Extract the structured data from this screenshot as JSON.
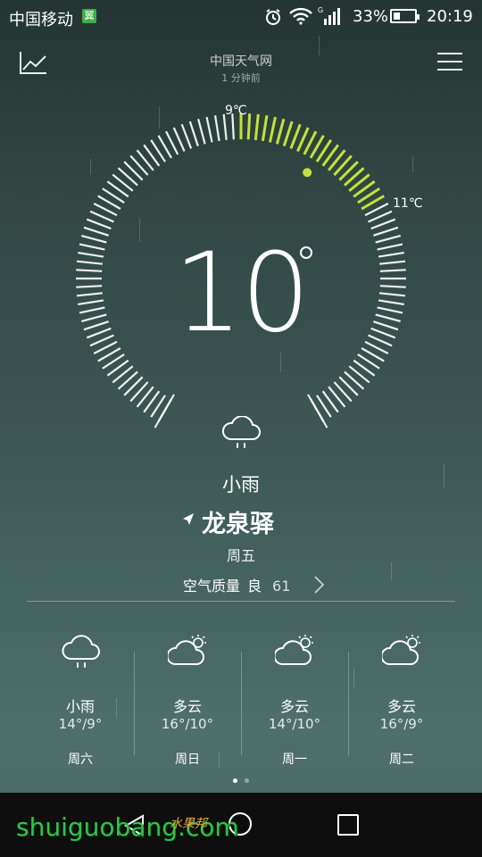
{
  "status_bar": {
    "carrier": "中国移动",
    "carrier_badge": "翼",
    "battery": "33%",
    "battery_level": 0.33,
    "time": "20:19",
    "icons": [
      "alarm-icon",
      "wifi-icon",
      "signal-icon",
      "battery-icon"
    ]
  },
  "header": {
    "source": "中国天气网",
    "updated": "1 分钟前",
    "icons": [
      "trend-chart-icon",
      "menu-icon"
    ]
  },
  "today": {
    "current_temp": "10",
    "high": "9℃",
    "low": "11℃",
    "condition": "小雨",
    "condition_icon": "light-rain-icon",
    "location": "龙泉驿",
    "weekday": "周五",
    "air_quality_label": "空气质量",
    "air_quality_level": "良",
    "air_quality_value": "61"
  },
  "forecast": [
    {
      "condition": "小雨",
      "range": "14°/9°",
      "day": "周六",
      "icon": "light-rain-icon"
    },
    {
      "condition": "多云",
      "range": "16°/10°",
      "day": "周日",
      "icon": "partly-cloudy-icon"
    },
    {
      "condition": "多云",
      "range": "14°/10°",
      "day": "周一",
      "icon": "partly-cloudy-icon"
    },
    {
      "condition": "多云",
      "range": "16°/9°",
      "day": "周二",
      "icon": "partly-cloudy-icon"
    }
  ],
  "pager": {
    "pages": 2,
    "current": 1
  },
  "colors": {
    "accent": "#c6e03a",
    "nav_bar": "#0e0e0e",
    "watermark": "#31c44a"
  },
  "watermark": {
    "text": "shuiguobang.com",
    "tag": "水果邦"
  }
}
